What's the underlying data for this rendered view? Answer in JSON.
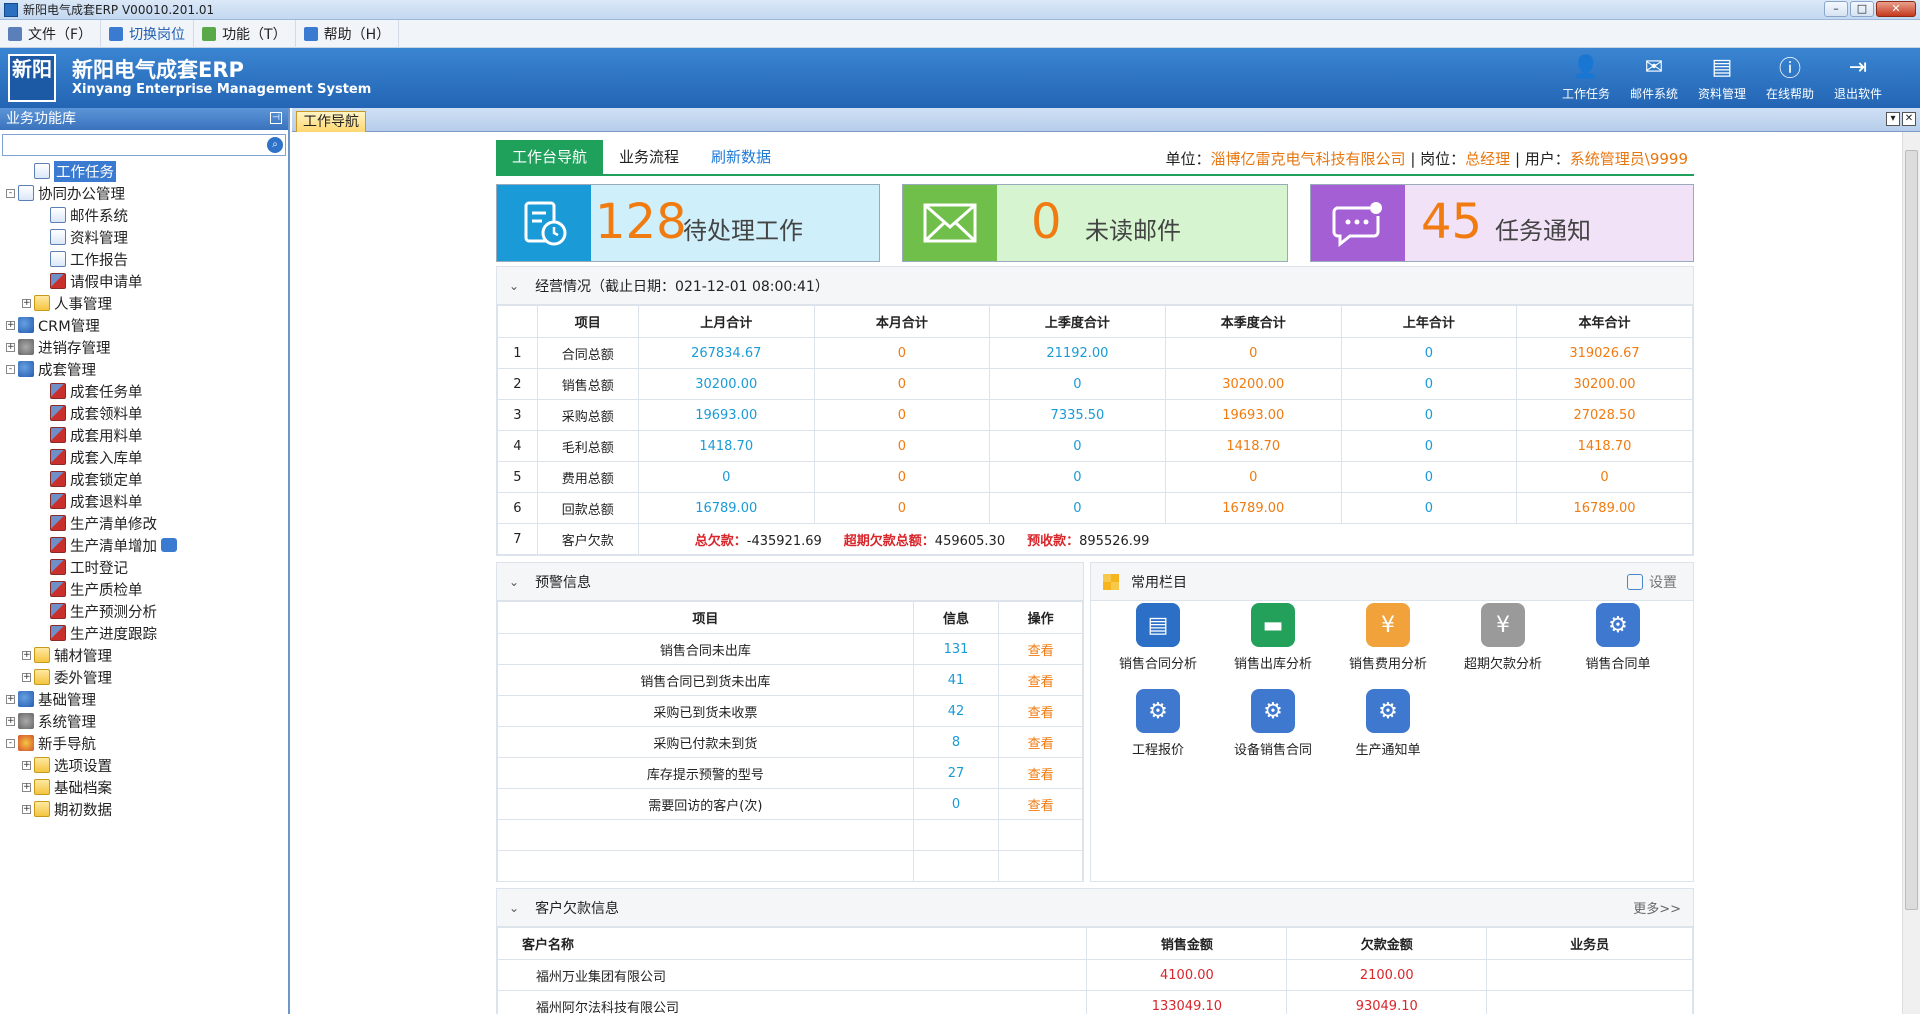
{
  "window": {
    "title": "新阳电气成套ERP V00010.201.01"
  },
  "menu": [
    {
      "label": "文件（F）",
      "icon": "menu-icon",
      "color": "#5b7fb8"
    },
    {
      "label": "切换岗位",
      "icon": "switch-icon",
      "color": "#3a7ad0"
    },
    {
      "label": "功能（T）",
      "icon": "tools-icon",
      "color": "#59a84a"
    },
    {
      "label": "帮助（H）",
      "icon": "help-icon",
      "color": "#3a7ad0"
    }
  ],
  "header": {
    "logo_text": "新阳",
    "brand_cn": "新阳电气成套ERP",
    "brand_en": "Xinyang Enterprise Management System",
    "buttons": [
      {
        "label": "工作任务",
        "icon": "task-icon"
      },
      {
        "label": "邮件系统",
        "icon": "mail-icon"
      },
      {
        "label": "资料管理",
        "icon": "document-icon"
      },
      {
        "label": "在线帮助",
        "icon": "info-icon"
      },
      {
        "label": "退出软件",
        "icon": "exit-icon"
      }
    ]
  },
  "sidebar": {
    "title": "业务功能库",
    "search_placeholder": "",
    "tree": [
      {
        "label": "工作任务",
        "level": 1,
        "icon": "doc",
        "selected": true
      },
      {
        "label": "协同办公管理",
        "level": 0,
        "icon": "doc",
        "expand": "-"
      },
      {
        "label": "邮件系统",
        "level": 2,
        "icon": "doc"
      },
      {
        "label": "资料管理",
        "level": 2,
        "icon": "doc"
      },
      {
        "label": "工作报告",
        "level": 2,
        "icon": "doc"
      },
      {
        "label": "请假申请单",
        "level": 2,
        "icon": "red"
      },
      {
        "label": "人事管理",
        "level": 1,
        "icon": "folder",
        "expand": "+"
      },
      {
        "label": "CRM管理",
        "level": 0,
        "icon": "grp",
        "expand": "+"
      },
      {
        "label": "进销存管理",
        "level": 0,
        "icon": "cfg",
        "expand": "+"
      },
      {
        "label": "成套管理",
        "level": 0,
        "icon": "grp",
        "expand": "-"
      },
      {
        "label": "成套任务单",
        "level": 2,
        "icon": "red"
      },
      {
        "label": "成套领料单",
        "level": 2,
        "icon": "red"
      },
      {
        "label": "成套用料单",
        "level": 2,
        "icon": "red"
      },
      {
        "label": "成套入库单",
        "level": 2,
        "icon": "red"
      },
      {
        "label": "成套锁定单",
        "level": 2,
        "icon": "red"
      },
      {
        "label": "成套退料单",
        "level": 2,
        "icon": "red"
      },
      {
        "label": "生产清单修改",
        "level": 2,
        "icon": "red"
      },
      {
        "label": "生产清单增加",
        "level": 2,
        "icon": "red",
        "badge": true
      },
      {
        "label": "工时登记",
        "level": 2,
        "icon": "red"
      },
      {
        "label": "生产质检单",
        "level": 2,
        "icon": "red"
      },
      {
        "label": "生产预测分析",
        "level": 2,
        "icon": "red"
      },
      {
        "label": "生产进度跟踪",
        "level": 2,
        "icon": "red"
      },
      {
        "label": "辅材管理",
        "level": 1,
        "icon": "folder",
        "expand": "+"
      },
      {
        "label": "委外管理",
        "level": 1,
        "icon": "folder",
        "expand": "+"
      },
      {
        "label": "基础管理",
        "level": 0,
        "icon": "grp",
        "expand": "+"
      },
      {
        "label": "系统管理",
        "level": 0,
        "icon": "cfg",
        "expand": "+"
      },
      {
        "label": "新手导航",
        "level": 0,
        "icon": "star",
        "expand": "-"
      },
      {
        "label": "选项设置",
        "level": 1,
        "icon": "folder",
        "expand": "+"
      },
      {
        "label": "基础档案",
        "level": 1,
        "icon": "folder",
        "expand": "+"
      },
      {
        "label": "期初数据",
        "level": 1,
        "icon": "folder",
        "expand": "+"
      }
    ]
  },
  "tabs": {
    "active": "工作导航"
  },
  "nav": {
    "tabs": [
      "工作台导航",
      "业务流程",
      "刷新数据"
    ],
    "unit_label": "单位：",
    "unit": "淄博亿雷克电气科技有限公司",
    "post_label": " | 岗位：",
    "post": "总经理",
    "user_label": " | 用户：",
    "user": "系统管理员\\9999"
  },
  "cards": [
    {
      "num": "128",
      "label": "待处理工作",
      "icon": "task-clock-icon",
      "color": "#1a9bd7",
      "bg": "#cfeffb"
    },
    {
      "num": "0",
      "label": "未读邮件",
      "icon": "envelope-icon",
      "color": "#6fbf4a",
      "bg": "#d6f4d0"
    },
    {
      "num": "45",
      "label": "任务通知",
      "icon": "message-icon",
      "color": "#a35fd3",
      "bg": "#f2e2f7"
    }
  ],
  "business": {
    "title": "经营情况（截止日期：021-12-01 08:00:41）",
    "headers": [
      "",
      "项目",
      "上月合计",
      "本月合计",
      "上季度合计",
      "本季度合计",
      "上年合计",
      "本年合计"
    ],
    "rows": [
      [
        "1",
        "合同总额",
        "267834.67",
        "0",
        "21192.00",
        "0",
        "0",
        "319026.67"
      ],
      [
        "2",
        "销售总额",
        "30200.00",
        "0",
        "0",
        "30200.00",
        "0",
        "30200.00"
      ],
      [
        "3",
        "采购总额",
        "19693.00",
        "0",
        "7335.50",
        "19693.00",
        "0",
        "27028.50"
      ],
      [
        "4",
        "毛利总额",
        "1418.70",
        "0",
        "0",
        "1418.70",
        "0",
        "1418.70"
      ],
      [
        "5",
        "费用总额",
        "0",
        "0",
        "0",
        "0",
        "0",
        "0"
      ],
      [
        "6",
        "回款总额",
        "16789.00",
        "0",
        "0",
        "16789.00",
        "0",
        "16789.00"
      ]
    ],
    "debt_row": {
      "idx": "7",
      "label": "客户欠款",
      "total_label": "总欠款：",
      "total": "-435921.69",
      "overdue_label": "超期欠款总额：",
      "overdue": "459605.30",
      "prepaid_label": "预收款：",
      "prepaid": "895526.99"
    }
  },
  "warning": {
    "title": "预警信息",
    "headers": [
      "项目",
      "信息",
      "操作"
    ],
    "rows": [
      [
        "销售合同未出库",
        "131",
        "查看"
      ],
      [
        "销售合同已到货未出库",
        "41",
        "查看"
      ],
      [
        "采购已到货未收票",
        "42",
        "查看"
      ],
      [
        "采购已付款未到货",
        "8",
        "查看"
      ],
      [
        "库存提示预警的型号",
        "27",
        "查看"
      ],
      [
        "需要回访的客户(次)",
        "0",
        "查看"
      ]
    ]
  },
  "quick": {
    "title": "常用栏目",
    "settings": "设置",
    "items": [
      {
        "label": "销售合同分析",
        "icon": "report-icon",
        "color": "#2c6fc6"
      },
      {
        "label": "销售出库分析",
        "icon": "bus-icon",
        "color": "#23a05a"
      },
      {
        "label": "销售费用分析",
        "icon": "money-bag-icon",
        "color": "#f2a23a"
      },
      {
        "label": "超期欠款分析",
        "icon": "yen-icon",
        "color": "#9a9a9a"
      },
      {
        "label": "销售合同单",
        "icon": "gear-icon",
        "color": "#3f78cf"
      },
      {
        "label": "工程报价",
        "icon": "gear-icon",
        "color": "#3f78cf"
      },
      {
        "label": "设备销售合同",
        "icon": "gear-icon",
        "color": "#3f78cf"
      },
      {
        "label": "生产通知单",
        "icon": "gear-icon",
        "color": "#3f78cf"
      }
    ]
  },
  "debt": {
    "title": "客户欠款信息",
    "more": "更多>>",
    "headers": [
      "客户名称",
      "销售金额",
      "欠款金额",
      "业务员"
    ],
    "rows": [
      [
        "福州万业集团有限公司",
        "4100.00",
        "2100.00",
        ""
      ],
      [
        "福州阿尔法科技有限公司",
        "133049.10",
        "93049.10",
        ""
      ]
    ]
  }
}
